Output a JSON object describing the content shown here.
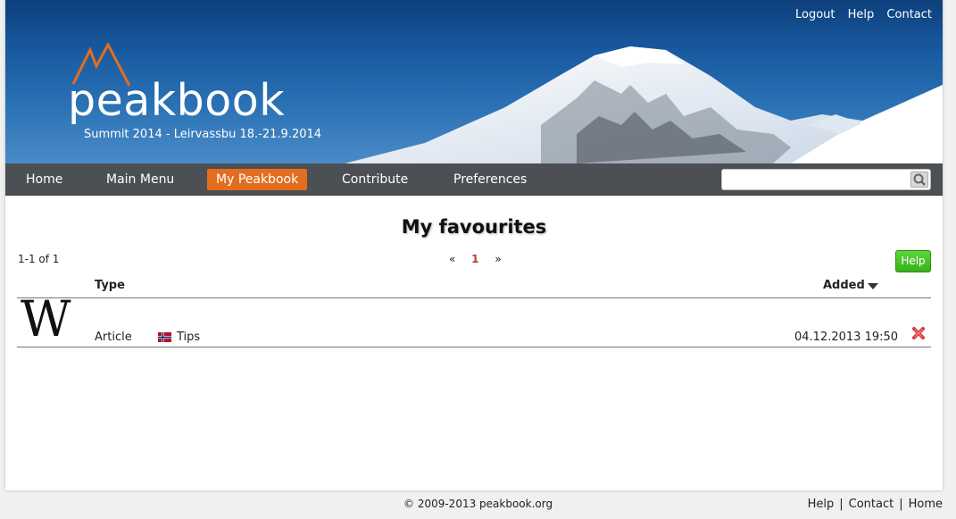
{
  "header": {
    "top_links": [
      "Logout",
      "Help",
      "Contact"
    ],
    "logo_text": "peakbook",
    "subtitle": "Summit 2014 - Leirvassbu 18.-21.9.2014"
  },
  "nav": {
    "items": [
      {
        "label": "Home",
        "active": false
      },
      {
        "label": "Main Menu",
        "active": false
      },
      {
        "label": "My Peakbook",
        "active": true
      },
      {
        "label": "Contribute",
        "active": false
      },
      {
        "label": "Preferences",
        "active": false
      }
    ],
    "search": {
      "placeholder": "",
      "value": "",
      "icon": "search-icon"
    }
  },
  "main": {
    "title": "My favourites",
    "count": "1-1 of 1",
    "pager": {
      "prev": "«",
      "current": "1",
      "next": "»"
    },
    "help_button": "Help",
    "table": {
      "headers": {
        "type": "Type",
        "added": "Added"
      },
      "rows": [
        {
          "thumb": "W",
          "type": "Article",
          "flag": "norway-flag",
          "title": "Tips",
          "added": "04.12.2013 19:50",
          "action": "delete-icon"
        }
      ]
    }
  },
  "footer": {
    "copyright": "© 2009-2013 peakbook.org",
    "links": [
      "Help",
      "Contact",
      "Home"
    ]
  },
  "colors": {
    "nav_bg": "#4c4f53",
    "accent_orange": "#e36d1e",
    "help_green": "#3cbf1e",
    "delete_red": "#d9383a"
  }
}
